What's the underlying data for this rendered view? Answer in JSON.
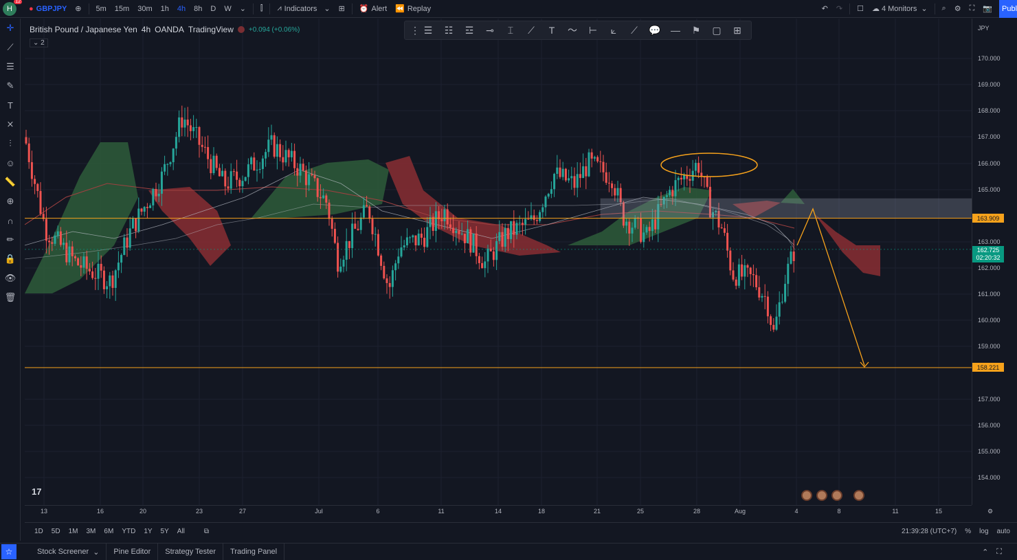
{
  "topbar": {
    "avatar_letter": "H",
    "badge": "12",
    "symbol": "GBPJPY",
    "intervals": [
      "5m",
      "15m",
      "30m",
      "1h",
      "4h",
      "8h",
      "D",
      "W"
    ],
    "active_interval": "4h",
    "indicators_label": "Indicators",
    "alert_label": "Alert",
    "replay_label": "Replay",
    "monitors_label": "4 Monitors",
    "publish_label": "Publ"
  },
  "legend": {
    "title": "British Pound / Japanese Yen",
    "interval": "4h",
    "exchange": "OANDA",
    "source": "TradingView",
    "change": "+0.094 (+0.06%)",
    "collapse_count": "2"
  },
  "price_scale": {
    "currency": "JPY",
    "labels": [
      "170.000",
      "169.000",
      "168.000",
      "167.000",
      "166.000",
      "165.000",
      "163.000",
      "162.000",
      "161.000",
      "160.000",
      "159.000",
      "157.000",
      "156.000",
      "155.000",
      "154.000"
    ],
    "tag_resistance": "163.909",
    "tag_current_price": "162.725",
    "tag_countdown": "02:20:32",
    "tag_support": "158.221"
  },
  "time_scale": {
    "labels": [
      "13",
      "16",
      "20",
      "23",
      "27",
      "Jul",
      "6",
      "11",
      "14",
      "18",
      "21",
      "25",
      "28",
      "Aug",
      "4",
      "8",
      "11",
      "15"
    ]
  },
  "range_bar": {
    "ranges": [
      "1D",
      "5D",
      "1M",
      "3M",
      "6M",
      "YTD",
      "1Y",
      "5Y",
      "All"
    ],
    "clock": "21:39:28 (UTC+7)",
    "percent": "%",
    "log": "log",
    "auto": "auto"
  },
  "bottom_tabs": [
    "Stock Screener",
    "Pine Editor",
    "Strategy Tester",
    "Trading Panel"
  ],
  "colors": {
    "bg": "#131722",
    "up": "#26a69a",
    "down": "#ef5350",
    "cloud_bull": "#2e5c3a",
    "cloud_bear": "#8a2e32",
    "accent": "#f7a21b"
  }
}
